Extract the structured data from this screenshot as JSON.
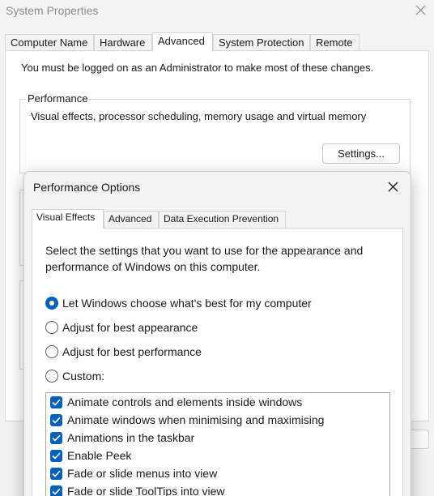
{
  "system_properties": {
    "title": "System Properties",
    "tabs": [
      {
        "label": "Computer Name"
      },
      {
        "label": "Hardware"
      },
      {
        "label": "Advanced"
      },
      {
        "label": "System Protection"
      },
      {
        "label": "Remote"
      }
    ],
    "active_tab": "Advanced",
    "admin_notice": "You must be logged on as an Administrator to make most of these changes.",
    "performance_group": {
      "legend": "Performance",
      "description": "Visual effects, processor scheduling, memory usage and virtual memory",
      "settings_button": "Settings..."
    }
  },
  "performance_options": {
    "title": "Performance Options",
    "tabs": [
      {
        "label": "Visual Effects"
      },
      {
        "label": "Advanced"
      },
      {
        "label": "Data Execution Prevention"
      }
    ],
    "active_tab": "Visual Effects",
    "intro": "Select the settings that you want to use for the appearance and performance of Windows on this computer.",
    "radios": [
      {
        "label": "Let Windows choose what's best for my computer",
        "checked": true
      },
      {
        "label": "Adjust for best appearance",
        "checked": false
      },
      {
        "label": "Adjust for best performance",
        "checked": false
      },
      {
        "label": "Custom:",
        "checked": false
      }
    ],
    "effects": [
      {
        "label": "Animate controls and elements inside windows",
        "checked": true
      },
      {
        "label": "Animate windows when minimising and maximising",
        "checked": true
      },
      {
        "label": "Animations in the taskbar",
        "checked": true
      },
      {
        "label": "Enable Peek",
        "checked": true
      },
      {
        "label": "Fade or slide menus into view",
        "checked": true
      },
      {
        "label": "Fade or slide ToolTips into view",
        "checked": true
      }
    ]
  },
  "colors": {
    "accent": "#005fb8",
    "window_bg": "#f3f3f3",
    "panel_bg": "#ffffff",
    "disabled_title": "#8c8c8c"
  }
}
